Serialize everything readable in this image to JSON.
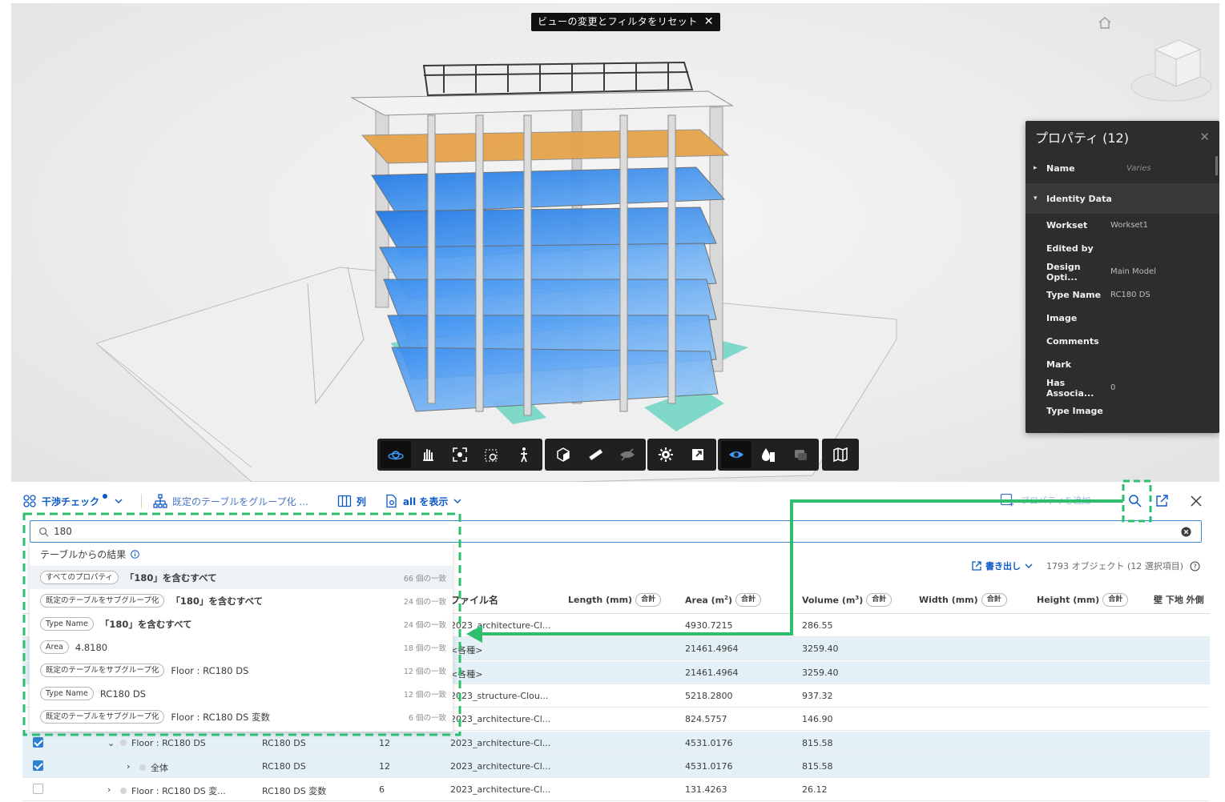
{
  "viewer": {
    "reset_chip_label": "ビューの変更とフィルタをリセット",
    "reset_chip_close": "✕"
  },
  "properties": {
    "title": "プロパティ (12)",
    "close": "✕",
    "rows": [
      {
        "group": false,
        "expander": "▸",
        "key": "Name",
        "value": "Varies"
      },
      {
        "group": true,
        "expander": "▾",
        "key": "Identity Data",
        "value": ""
      },
      {
        "key": "Workset",
        "value": "Workset1"
      },
      {
        "key": "Edited by",
        "value": ""
      },
      {
        "key": "Design Opti...",
        "value": "Main Model"
      },
      {
        "key": "Type Name",
        "value": "RC180 DS"
      },
      {
        "key": "Image",
        "value": ""
      },
      {
        "key": "Comments",
        "value": ""
      },
      {
        "key": "Mark",
        "value": ""
      },
      {
        "key": "Has Associa...",
        "value": "0"
      },
      {
        "key": "Type Image",
        "value": ""
      }
    ]
  },
  "toolbar": {
    "groups": [
      [
        "orbit-icon",
        "pan-icon",
        "fit-icon",
        "zoom-window-icon",
        "walk-icon"
      ],
      [
        "section-box-icon",
        "measure-icon",
        "hide-icon"
      ],
      [
        "settings-icon",
        "fullscreen-icon"
      ],
      [
        "ghost-eye-icon",
        "water-drop-icon",
        "layers-icon"
      ],
      [
        "map-icon"
      ]
    ]
  },
  "panel": {
    "clash_label": "干渉チェック",
    "group_label": "既定のテーブルをグループ化 ...",
    "columns_label": "列",
    "show_label": "all を表示",
    "add_property_label": "プロパティを追加"
  },
  "search": {
    "value": "180"
  },
  "dropdown": {
    "header": "テーブルからの結果",
    "rows": [
      {
        "tag": "すべてのプロパティ",
        "text": "「180」を含むすべて",
        "bold": true,
        "count": "66 個の一致"
      },
      {
        "tag": "既定のテーブルをサブグループ化",
        "text": "「180」を含むすべて",
        "bold": true,
        "count": "24 個の一致"
      },
      {
        "tag": "Type Name",
        "text": "「180」を含むすべて",
        "bold": true,
        "count": "24 個の一致"
      },
      {
        "tag": "Area",
        "text": "4.8180",
        "bold": false,
        "count": "18 個の一致"
      },
      {
        "tag": "既定のテーブルをサブグループ化",
        "text": "Floor : RC180 DS",
        "bold": false,
        "count": "12 個の一致"
      },
      {
        "tag": "Type Name",
        "text": "RC180 DS",
        "bold": false,
        "count": "12 個の一致"
      },
      {
        "tag": "既定のテーブルをサブグループ化",
        "text": "Floor : RC180 DS 変数",
        "bold": false,
        "count": "6 個の一致"
      }
    ]
  },
  "table": {
    "export_label": "書き出し",
    "object_count": "1793 オブジェクト (12 選択項目)",
    "headers": {
      "file": "ファイル名",
      "length": "Length (mm)",
      "area": "Area (m",
      "area_unit_suffix": ")",
      "volume": "Volume (m",
      "volume_unit_suffix": ")",
      "width": "Width (mm)",
      "height": "Height (mm)",
      "wall": "壁 下地 外側",
      "sum": "合計",
      "sq": "2",
      "cube": "3"
    },
    "rows": [
      {
        "file": "2023_architecture-Cl...",
        "area": "4930.7215",
        "volume": "286.55"
      },
      {
        "file": "<各種>",
        "area": "21461.4964",
        "volume": "3259.40"
      },
      {
        "file": "<各種>",
        "area": "21461.4964",
        "volume": "3259.40"
      },
      {
        "file": "2023_structure-Clou...",
        "area": "5218.2800",
        "volume": "937.32"
      },
      {
        "file": "2023_architecture-Cl...",
        "area": "824.5757",
        "volume": "146.90"
      },
      {
        "name": "Floor : RC180 DS",
        "type": "RC180 DS",
        "count": "12",
        "file": "2023_architecture-Cl...",
        "area": "4531.0176",
        "volume": "815.58"
      },
      {
        "name": "全体",
        "type": "RC180 DS",
        "count": "12",
        "file": "2023_architecture-Cl...",
        "area": "4531.0176",
        "volume": "815.58"
      },
      {
        "name": "Floor : RC180 DS 変...",
        "type": "RC180 DS 変数",
        "count": "6",
        "file": "2023_architecture-Cl...",
        "area": "131.4263",
        "volume": "26.12"
      }
    ]
  },
  "colors": {
    "accent": "#0a59c9",
    "annotation": "#2dbf6e",
    "selected_row": "#e3f0f6",
    "floor_orange": "#e6a34a",
    "floor_blue": "#2c87e8"
  }
}
